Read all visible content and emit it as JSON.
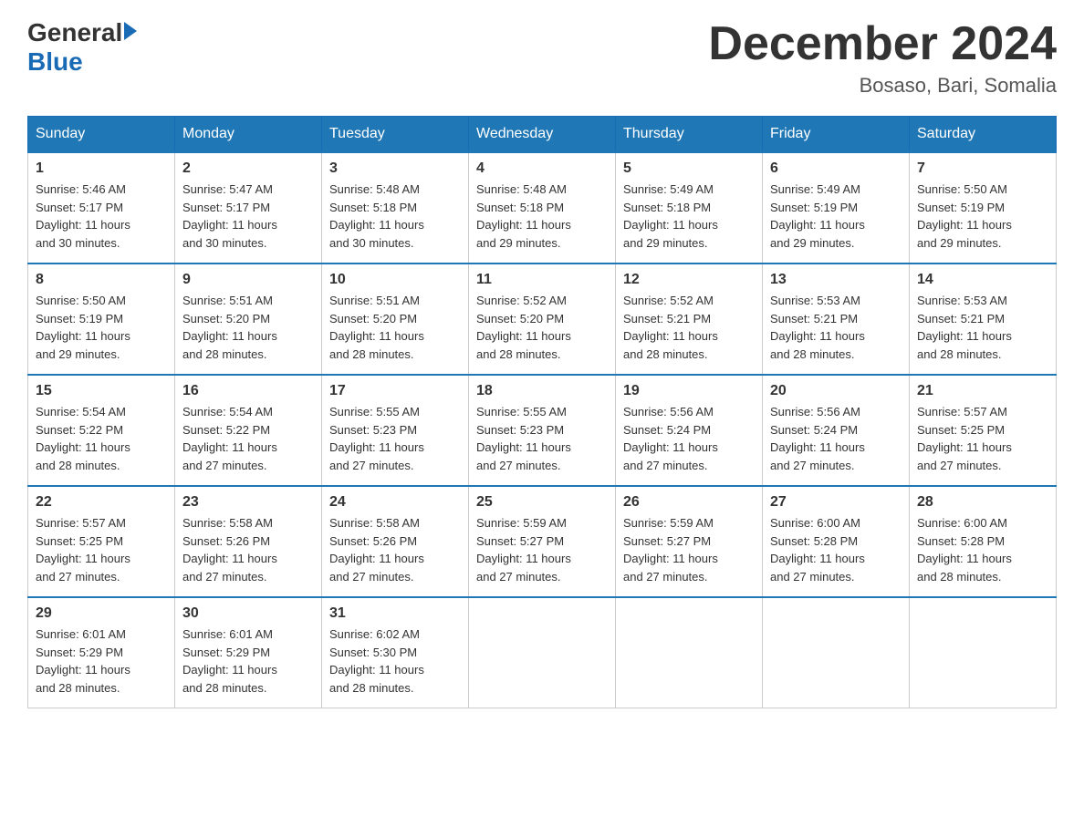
{
  "header": {
    "logo": {
      "general": "General",
      "blue": "Blue"
    },
    "title": "December 2024",
    "location": "Bosaso, Bari, Somalia"
  },
  "weekdays": [
    "Sunday",
    "Monday",
    "Tuesday",
    "Wednesday",
    "Thursday",
    "Friday",
    "Saturday"
  ],
  "weeks": [
    [
      {
        "day": "1",
        "sunrise": "5:46 AM",
        "sunset": "5:17 PM",
        "daylight": "11 hours and 30 minutes."
      },
      {
        "day": "2",
        "sunrise": "5:47 AM",
        "sunset": "5:17 PM",
        "daylight": "11 hours and 30 minutes."
      },
      {
        "day": "3",
        "sunrise": "5:48 AM",
        "sunset": "5:18 PM",
        "daylight": "11 hours and 30 minutes."
      },
      {
        "day": "4",
        "sunrise": "5:48 AM",
        "sunset": "5:18 PM",
        "daylight": "11 hours and 29 minutes."
      },
      {
        "day": "5",
        "sunrise": "5:49 AM",
        "sunset": "5:18 PM",
        "daylight": "11 hours and 29 minutes."
      },
      {
        "day": "6",
        "sunrise": "5:49 AM",
        "sunset": "5:19 PM",
        "daylight": "11 hours and 29 minutes."
      },
      {
        "day": "7",
        "sunrise": "5:50 AM",
        "sunset": "5:19 PM",
        "daylight": "11 hours and 29 minutes."
      }
    ],
    [
      {
        "day": "8",
        "sunrise": "5:50 AM",
        "sunset": "5:19 PM",
        "daylight": "11 hours and 29 minutes."
      },
      {
        "day": "9",
        "sunrise": "5:51 AM",
        "sunset": "5:20 PM",
        "daylight": "11 hours and 28 minutes."
      },
      {
        "day": "10",
        "sunrise": "5:51 AM",
        "sunset": "5:20 PM",
        "daylight": "11 hours and 28 minutes."
      },
      {
        "day": "11",
        "sunrise": "5:52 AM",
        "sunset": "5:20 PM",
        "daylight": "11 hours and 28 minutes."
      },
      {
        "day": "12",
        "sunrise": "5:52 AM",
        "sunset": "5:21 PM",
        "daylight": "11 hours and 28 minutes."
      },
      {
        "day": "13",
        "sunrise": "5:53 AM",
        "sunset": "5:21 PM",
        "daylight": "11 hours and 28 minutes."
      },
      {
        "day": "14",
        "sunrise": "5:53 AM",
        "sunset": "5:21 PM",
        "daylight": "11 hours and 28 minutes."
      }
    ],
    [
      {
        "day": "15",
        "sunrise": "5:54 AM",
        "sunset": "5:22 PM",
        "daylight": "11 hours and 28 minutes."
      },
      {
        "day": "16",
        "sunrise": "5:54 AM",
        "sunset": "5:22 PM",
        "daylight": "11 hours and 27 minutes."
      },
      {
        "day": "17",
        "sunrise": "5:55 AM",
        "sunset": "5:23 PM",
        "daylight": "11 hours and 27 minutes."
      },
      {
        "day": "18",
        "sunrise": "5:55 AM",
        "sunset": "5:23 PM",
        "daylight": "11 hours and 27 minutes."
      },
      {
        "day": "19",
        "sunrise": "5:56 AM",
        "sunset": "5:24 PM",
        "daylight": "11 hours and 27 minutes."
      },
      {
        "day": "20",
        "sunrise": "5:56 AM",
        "sunset": "5:24 PM",
        "daylight": "11 hours and 27 minutes."
      },
      {
        "day": "21",
        "sunrise": "5:57 AM",
        "sunset": "5:25 PM",
        "daylight": "11 hours and 27 minutes."
      }
    ],
    [
      {
        "day": "22",
        "sunrise": "5:57 AM",
        "sunset": "5:25 PM",
        "daylight": "11 hours and 27 minutes."
      },
      {
        "day": "23",
        "sunrise": "5:58 AM",
        "sunset": "5:26 PM",
        "daylight": "11 hours and 27 minutes."
      },
      {
        "day": "24",
        "sunrise": "5:58 AM",
        "sunset": "5:26 PM",
        "daylight": "11 hours and 27 minutes."
      },
      {
        "day": "25",
        "sunrise": "5:59 AM",
        "sunset": "5:27 PM",
        "daylight": "11 hours and 27 minutes."
      },
      {
        "day": "26",
        "sunrise": "5:59 AM",
        "sunset": "5:27 PM",
        "daylight": "11 hours and 27 minutes."
      },
      {
        "day": "27",
        "sunrise": "6:00 AM",
        "sunset": "5:28 PM",
        "daylight": "11 hours and 27 minutes."
      },
      {
        "day": "28",
        "sunrise": "6:00 AM",
        "sunset": "5:28 PM",
        "daylight": "11 hours and 28 minutes."
      }
    ],
    [
      {
        "day": "29",
        "sunrise": "6:01 AM",
        "sunset": "5:29 PM",
        "daylight": "11 hours and 28 minutes."
      },
      {
        "day": "30",
        "sunrise": "6:01 AM",
        "sunset": "5:29 PM",
        "daylight": "11 hours and 28 minutes."
      },
      {
        "day": "31",
        "sunrise": "6:02 AM",
        "sunset": "5:30 PM",
        "daylight": "11 hours and 28 minutes."
      },
      null,
      null,
      null,
      null
    ]
  ],
  "labels": {
    "sunrise": "Sunrise:",
    "sunset": "Sunset:",
    "daylight": "Daylight:"
  }
}
